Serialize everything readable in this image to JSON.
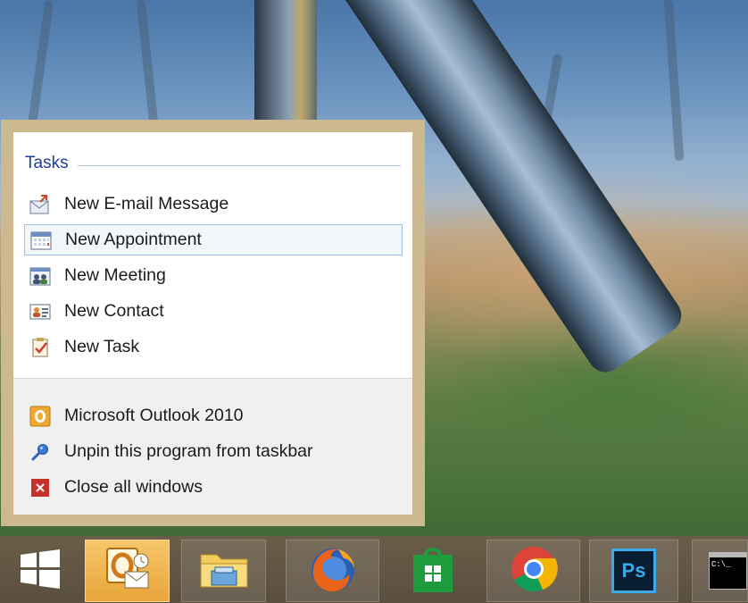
{
  "jumplist": {
    "section_title": "Tasks",
    "tasks": [
      {
        "label": "New E-mail Message",
        "icon": "new-email-icon"
      },
      {
        "label": "New Appointment",
        "icon": "calendar-icon"
      },
      {
        "label": "New Meeting",
        "icon": "meeting-icon"
      },
      {
        "label": "New Contact",
        "icon": "contact-card-icon"
      },
      {
        "label": "New Task",
        "icon": "task-clipboard-icon"
      }
    ],
    "footer": [
      {
        "label": "Microsoft Outlook 2010",
        "icon": "outlook-icon"
      },
      {
        "label": "Unpin this program from taskbar",
        "icon": "unpin-icon"
      },
      {
        "label": "Close all windows",
        "icon": "close-windows-icon"
      }
    ]
  },
  "taskbar": {
    "items": [
      {
        "name": "Start",
        "icon": "windows-start-icon"
      },
      {
        "name": "Microsoft Outlook 2010",
        "icon": "outlook-icon",
        "state": "active"
      },
      {
        "name": "File Explorer",
        "icon": "folder-icon"
      },
      {
        "name": "Firefox",
        "icon": "firefox-icon"
      },
      {
        "name": "Store",
        "icon": "store-icon"
      },
      {
        "name": "Chrome",
        "icon": "chrome-icon"
      },
      {
        "name": "Photoshop",
        "icon": "photoshop-icon",
        "text": "Ps"
      },
      {
        "name": "Command Prompt",
        "icon": "command-prompt-icon",
        "text": "C:\\_"
      }
    ]
  },
  "colors": {
    "accent": "#1e3f9a",
    "popup_border": "#cdb98f",
    "hover_border": "#9cc0e4",
    "taskbar": "#5f5343",
    "outlook_orange": "#f0a830"
  }
}
